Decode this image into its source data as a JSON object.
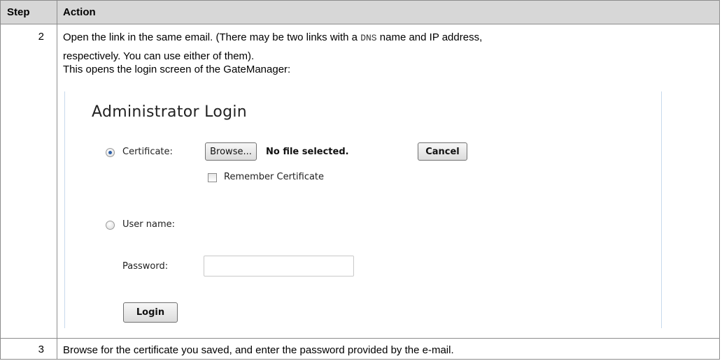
{
  "table": {
    "headers": {
      "step": "Step",
      "action": "Action"
    },
    "rows": [
      {
        "step": "2",
        "line1_pre": "Open the link in the same email. (There may be two links with a ",
        "line1_mono": "DNS",
        "line1_post": " name and IP address,",
        "line2": "respectively. You can use either of them).",
        "line3": "This opens the login screen of the GateManager:"
      },
      {
        "step": "3",
        "text": "Browse for the certificate you saved, and enter the password provided by the e-mail."
      }
    ]
  },
  "login_screen": {
    "title": "Administrator Login",
    "certificate_label": "Certificate:",
    "browse_button": "Browse...",
    "file_status": "No file selected.",
    "cancel_button": "Cancel",
    "remember_label": "Remember Certificate",
    "username_label": "User name:",
    "password_label": "Password:",
    "password_value": "",
    "login_button": "Login",
    "certificate_selected": true,
    "remember_checked": false
  }
}
